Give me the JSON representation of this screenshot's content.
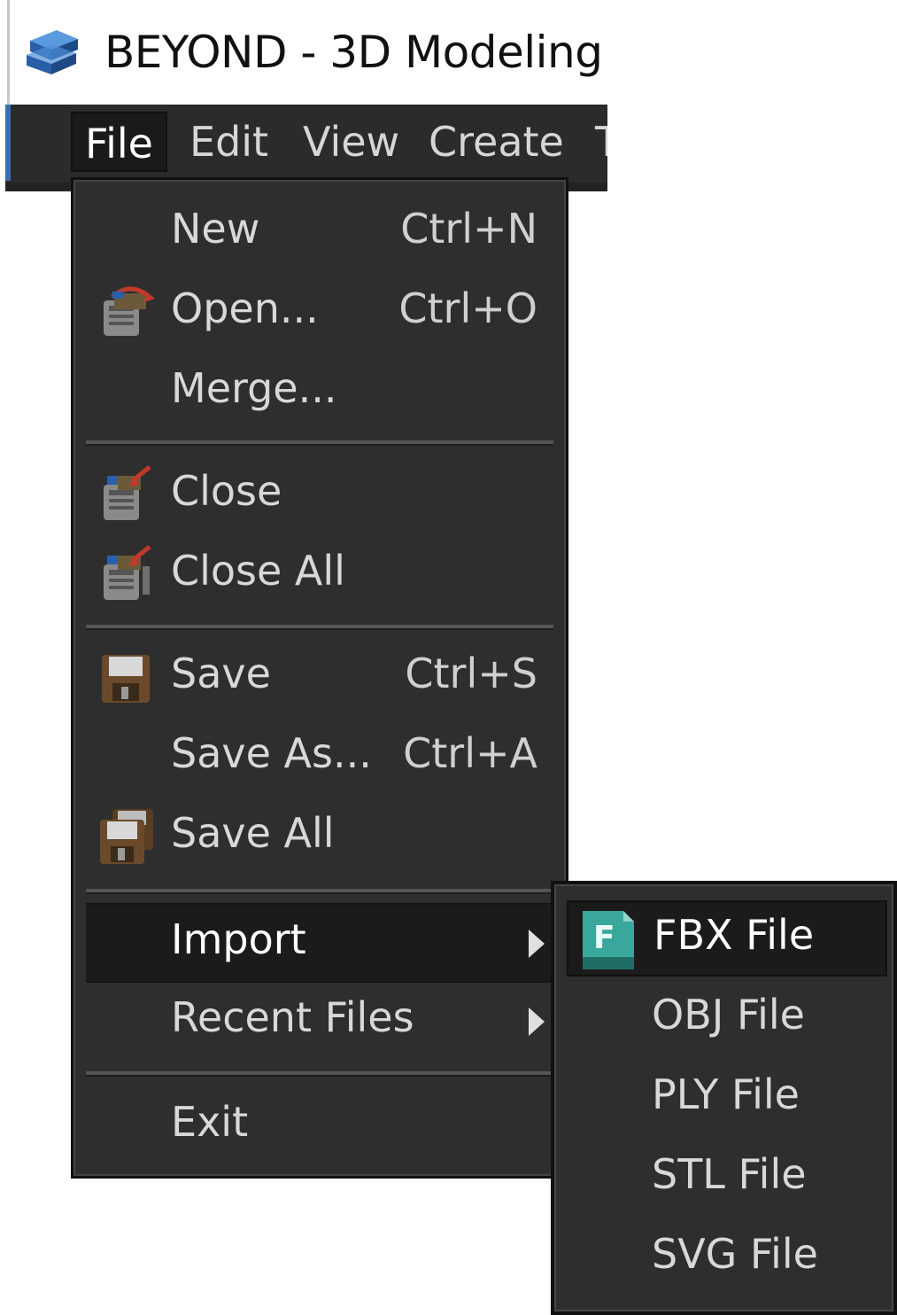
{
  "window": {
    "title": "BEYOND - 3D Modeling",
    "app_icon": "beyond-logo-icon"
  },
  "menubar": {
    "items": [
      {
        "label": "File",
        "active": true
      },
      {
        "label": "Edit"
      },
      {
        "label": "View"
      },
      {
        "label": "Create"
      },
      {
        "label": "T"
      }
    ]
  },
  "file_menu": {
    "items": [
      {
        "label": "New",
        "shortcut": "Ctrl+N",
        "icon": null
      },
      {
        "label": "Open...",
        "shortcut": "Ctrl+O",
        "icon": "open-folder-icon"
      },
      {
        "label": "Merge...",
        "shortcut": "",
        "icon": null
      },
      {
        "label": "Close",
        "shortcut": "",
        "icon": "close-file-icon"
      },
      {
        "label": "Close All",
        "shortcut": "",
        "icon": "close-all-icon"
      },
      {
        "label": "Save",
        "shortcut": "Ctrl+S",
        "icon": "floppy-disk-icon"
      },
      {
        "label": "Save As...",
        "shortcut": "Ctrl+A",
        "icon": null
      },
      {
        "label": "Save All",
        "shortcut": "",
        "icon": "save-all-icon"
      },
      {
        "label": "Import",
        "shortcut": "",
        "icon": null,
        "submenu": true,
        "highlighted": true
      },
      {
        "label": "Recent Files",
        "shortcut": "",
        "icon": null,
        "submenu": true
      },
      {
        "label": "Exit",
        "shortcut": "",
        "icon": null
      }
    ]
  },
  "import_submenu": {
    "items": [
      {
        "label": "FBX File",
        "icon": "fbx-file-icon",
        "highlighted": true
      },
      {
        "label": "OBJ File"
      },
      {
        "label": "PLY File"
      },
      {
        "label": "STL File"
      },
      {
        "label": "SVG File"
      }
    ]
  },
  "colors": {
    "menu_bg": "#2e2e2e",
    "highlight_bg": "#1b1b1b",
    "text": "#d8d8d8",
    "fbx_teal": "#3aa79c"
  }
}
